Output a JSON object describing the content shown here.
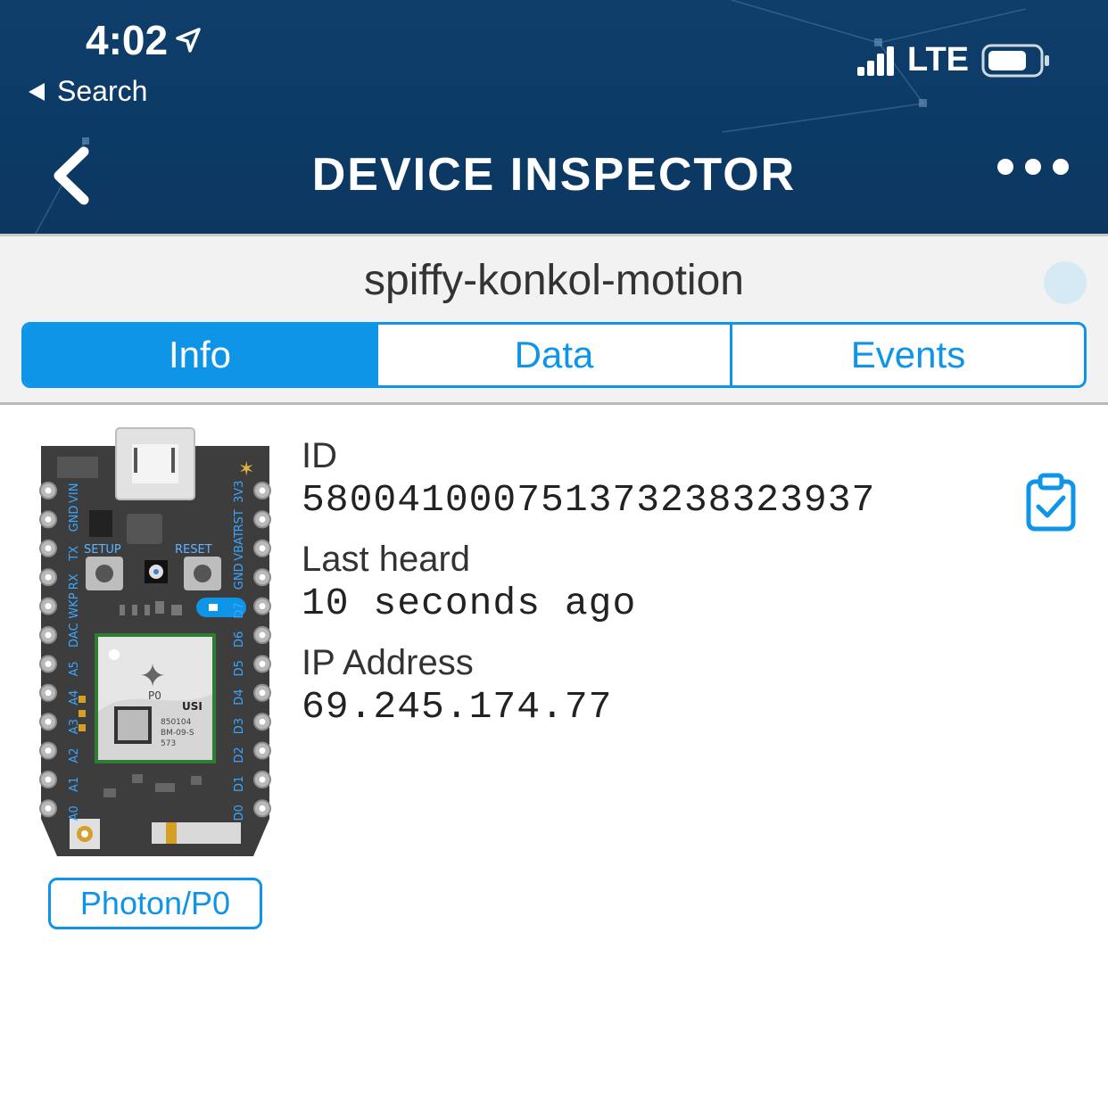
{
  "status_bar": {
    "time": "4:02",
    "back_app": "Search",
    "network": "LTE",
    "location_icon": "location-arrow-icon",
    "signal_icon": "cellular-signal-icon",
    "battery_icon": "battery-icon"
  },
  "header": {
    "title": "DEVICE INSPECTOR",
    "back_icon": "chevron-left-icon",
    "more_icon": "more-dots-icon",
    "background": "#0d3a66"
  },
  "device": {
    "name": "spiffy-konkol-motion",
    "status_color": "#d6eaf5"
  },
  "tabs": [
    {
      "label": "Info",
      "active": true
    },
    {
      "label": "Data",
      "active": false
    },
    {
      "label": "Events",
      "active": false
    }
  ],
  "board": {
    "platform_badge": "Photon/P0",
    "left_pins": [
      "VIN",
      "GND",
      "TX",
      "RX",
      "WKP",
      "DAC",
      "A5",
      "A4",
      "A3",
      "A2",
      "A1",
      "A0"
    ],
    "right_pins": [
      "3V3",
      "RST",
      "VBAT",
      "GND",
      "D7",
      "D6",
      "D5",
      "D4",
      "D3",
      "D2",
      "D1",
      "D0"
    ],
    "buttons": [
      "SETUP",
      "RESET"
    ],
    "module_label": "P0",
    "module_brand": "USI",
    "module_codes": [
      "850104",
      "BM-09-S",
      "573"
    ]
  },
  "info": {
    "id_label": "ID",
    "id_value": "5800410007513732383​23937",
    "last_heard_label": "Last heard",
    "last_heard_value": "10 seconds ago",
    "ip_label": "IP Address",
    "ip_value": "69.245.174.77",
    "copy_icon": "clipboard-check-icon"
  },
  "accent_color": "#0e95e8"
}
